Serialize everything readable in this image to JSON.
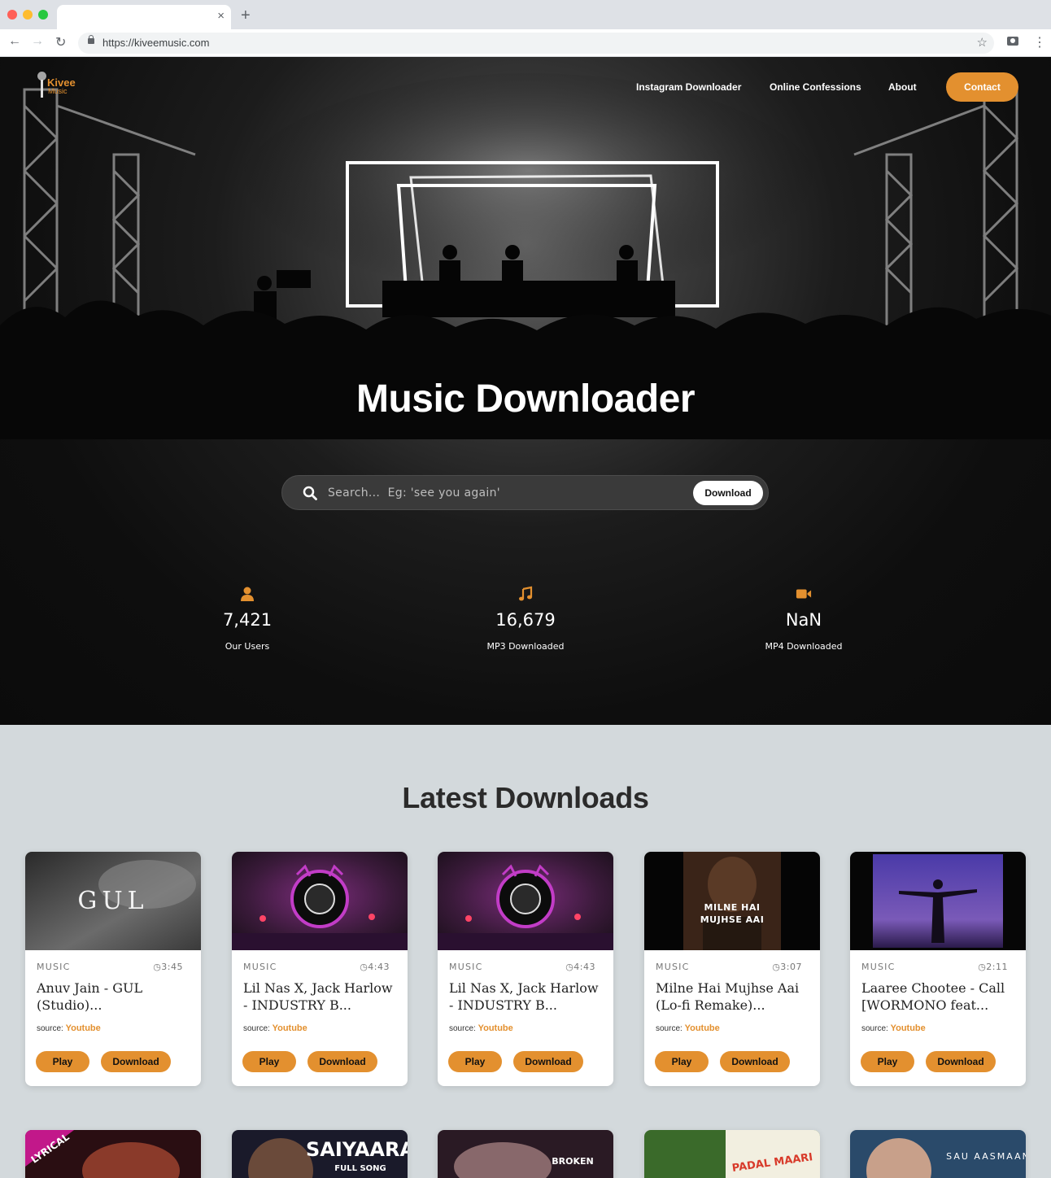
{
  "browser": {
    "url": "https://kiveemusic.com",
    "tab_close": "×",
    "new_tab": "+"
  },
  "logo": {
    "name": "Kivee",
    "sub": "Music"
  },
  "nav": {
    "links": [
      "Instagram Downloader",
      "Online Confessions",
      "About"
    ],
    "contact": "Contact"
  },
  "hero": {
    "title": "Music Downloader",
    "search_placeholder": "Search...  Eg: 'see you again'",
    "search_button": "Download"
  },
  "stats": [
    {
      "icon": "user-icon",
      "value": "7,421",
      "label": "Our Users"
    },
    {
      "icon": "music-note-icon",
      "value": "16,679",
      "label": "MP3 Downloaded"
    },
    {
      "icon": "video-camera-icon",
      "value": "NaN",
      "label": "MP4 Downloaded"
    }
  ],
  "latest": {
    "title": "Latest Downloads",
    "cards": [
      {
        "category": "MUSIC",
        "duration": "3:45",
        "title": "Anuv Jain - GUL (Studio)...",
        "source_label": "source:",
        "source": "Youtube",
        "play": "Play",
        "download": "Download",
        "thumb_text": "GUL"
      },
      {
        "category": "MUSIC",
        "duration": "4:43",
        "title": "Lil Nas X, Jack Harlow - INDUSTRY B...",
        "source_label": "source:",
        "source": "Youtube",
        "play": "Play",
        "download": "Download",
        "thumb_text": ""
      },
      {
        "category": "MUSIC",
        "duration": "4:43",
        "title": "Lil Nas X, Jack Harlow - INDUSTRY B...",
        "source_label": "source:",
        "source": "Youtube",
        "play": "Play",
        "download": "Download",
        "thumb_text": ""
      },
      {
        "category": "MUSIC",
        "duration": "3:07",
        "title": "Milne Hai Mujhse Aai (Lo-fi Remake)...",
        "source_label": "source:",
        "source": "Youtube",
        "play": "Play",
        "download": "Download",
        "thumb_text": "MILNE HAI MUJHSE AAI"
      },
      {
        "category": "MUSIC",
        "duration": "2:11",
        "title": "Laaree Chootee - Call [WORMONO feat...",
        "source_label": "source:",
        "source": "Youtube",
        "play": "Play",
        "download": "Download",
        "thumb_text": ""
      }
    ],
    "next_row_thumbs": [
      "LYRICAL",
      "SAIYAARA",
      "BROKEN",
      "PADAL MAARI",
      "SAU AASMAAN"
    ]
  },
  "colors": {
    "accent": "#e3902f",
    "hero_bg": "#0e0e0e",
    "section_bg": "#d3d9dc"
  }
}
